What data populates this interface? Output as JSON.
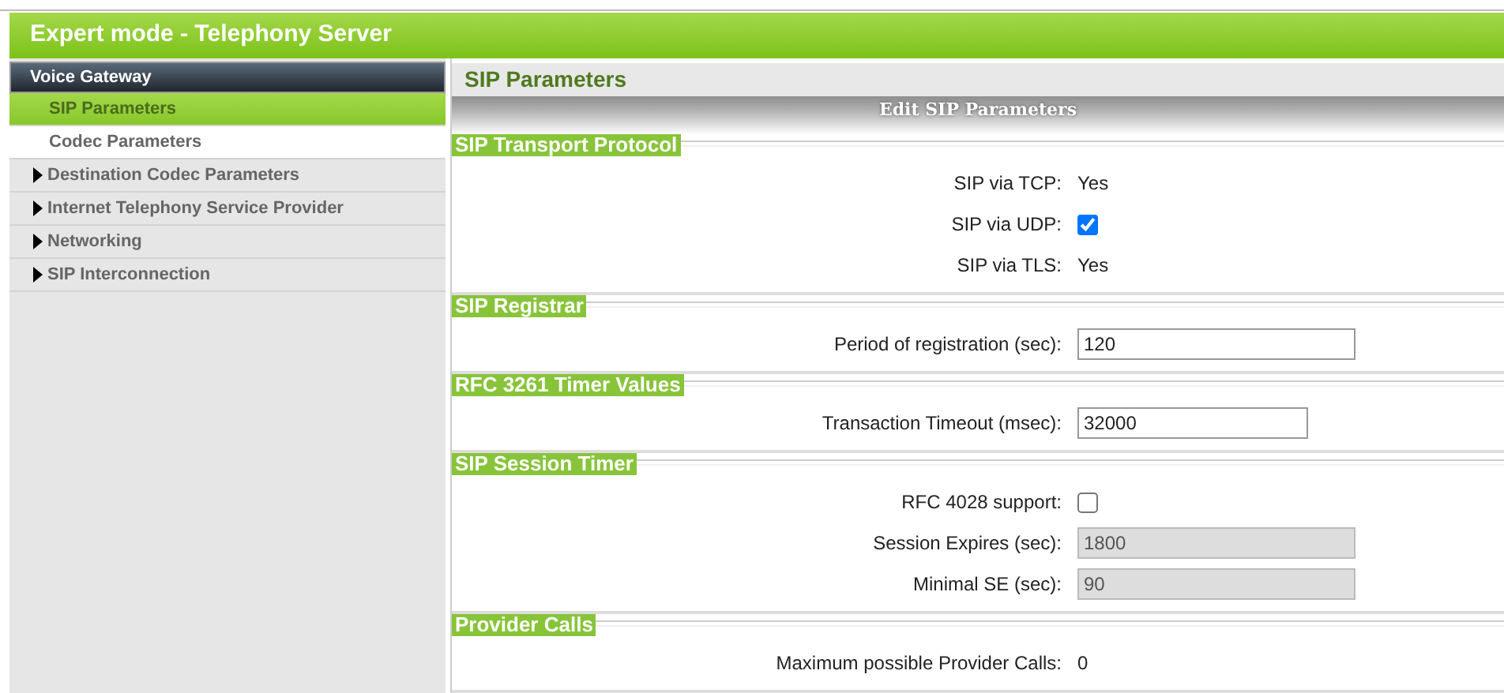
{
  "window": {
    "title": "Expert mode - Telephony Server"
  },
  "sidebar": {
    "group": "Voice Gateway",
    "items": [
      {
        "label": "SIP Parameters",
        "kind": "sub",
        "selected": true
      },
      {
        "label": "Codec Parameters",
        "kind": "sub",
        "selected": false
      },
      {
        "label": "Destination Codec Parameters",
        "kind": "folder",
        "expanded": false
      },
      {
        "label": "Internet Telephony Service Provider",
        "kind": "folder",
        "expanded": false
      },
      {
        "label": "Networking",
        "kind": "folder",
        "expanded": false
      },
      {
        "label": "SIP Interconnection",
        "kind": "folder",
        "expanded": false
      }
    ]
  },
  "page_title": "SIP Parameters",
  "form_title": "Edit SIP Parameters",
  "sections": [
    {
      "title": "SIP Transport Protocol",
      "fields": [
        {
          "label": "SIP via TCP:",
          "kind": "text",
          "value": "Yes"
        },
        {
          "label": "SIP via UDP:",
          "kind": "checkbox",
          "checked": true
        },
        {
          "label": "SIP via TLS:",
          "kind": "text",
          "value": "Yes"
        }
      ]
    },
    {
      "title": "SIP Registrar",
      "fields": [
        {
          "label": "Period of registration (sec):",
          "kind": "input",
          "value": "120",
          "disabled": false,
          "wide": true
        }
      ]
    },
    {
      "title": "RFC 3261 Timer Values",
      "fields": [
        {
          "label": "Transaction Timeout (msec):",
          "kind": "input",
          "value": "32000",
          "disabled": false,
          "wide": false
        }
      ]
    },
    {
      "title": "SIP Session Timer",
      "fields": [
        {
          "label": "RFC 4028 support:",
          "kind": "checkbox",
          "checked": false
        },
        {
          "label": "Session Expires (sec):",
          "kind": "input",
          "value": "1800",
          "disabled": true,
          "wide": true
        },
        {
          "label": "Minimal SE (sec):",
          "kind": "input",
          "value": "90",
          "disabled": true,
          "wide": true
        }
      ]
    },
    {
      "title": "Provider Calls",
      "fields": [
        {
          "label": "Maximum possible Provider Calls:",
          "kind": "text",
          "value": "0"
        }
      ]
    }
  ]
}
